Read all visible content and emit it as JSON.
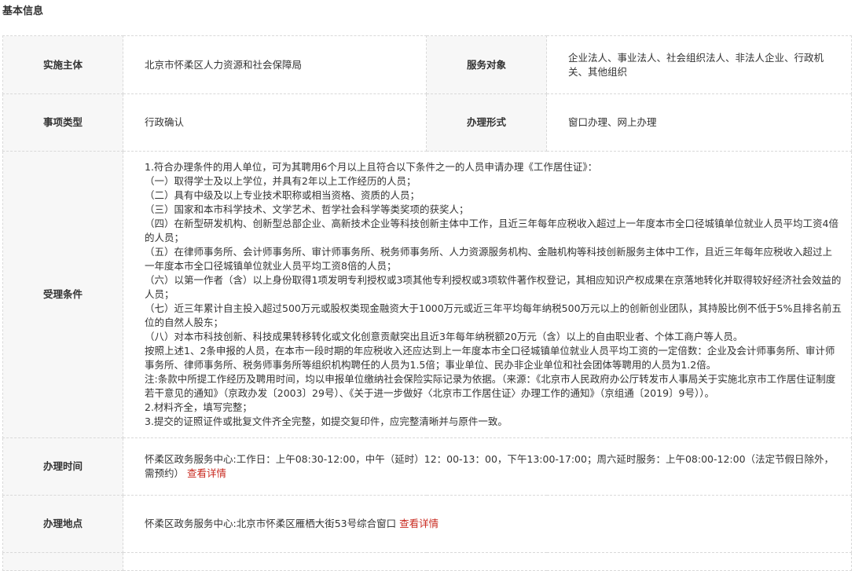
{
  "section": {
    "title": "基本信息"
  },
  "rows": {
    "implementer": {
      "label": "实施主体",
      "value": "北京市怀柔区人力资源和社会保障局"
    },
    "service_target": {
      "label": "服务对象",
      "value": "企业法人、事业法人、社会组织法人、非法人企业、行政机关、其他组织"
    },
    "item_type": {
      "label": "事项类型",
      "value": "行政确认"
    },
    "handling_form": {
      "label": "办理形式",
      "value": "窗口办理、网上办理"
    },
    "conditions": {
      "label": "受理条件",
      "lines": [
        "1.符合办理条件的用人单位，可为其聘用6个月以上且符合以下条件之一的人员申请办理《工作居住证》：",
        "（一）取得学士及以上学位，并具有2年以上工作经历的人员；",
        "（二）具有中级及以上专业技术职称或相当资格、资质的人员；",
        "（三）国家和本市科学技术、文学艺术、哲学社会科学等类奖项的获奖人；",
        "（四）在新型研发机构、创新型总部企业、高新技术企业等科技创新主体中工作，且近三年每年应税收入超过上一年度本市全口径城镇单位就业人员平均工资4倍的人员；",
        "（五）在律师事务所、会计师事务所、审计师事务所、税务师事务所、人力资源服务机构、金融机构等科技创新服务主体中工作，且近三年每年应税收入超过上一年度本市全口径城镇单位就业人员平均工资8倍的人员；",
        "（六）以第一作者（含）以上身份取得1项发明专利授权或3项其他专利授权或3项软件著作权登记，其相应知识产权成果在京落地转化并取得较好经济社会效益的人员；",
        "（七）近三年累计自主投入超过500万元或股权类现金融资大于1000万元或近三年平均每年纳税500万元以上的创新创业团队，其持股比例不低于5%且排名前五位的自然人股东；",
        "（八）对本市科技创新、科技成果转移转化或文化创意贡献突出且近3年每年纳税额20万元（含）以上的自由职业者、个体工商户等人员。",
        "按照上述1、2条申报的人员，在本市一段时期的年应税收入还应达到上一年度本市全口径城镇单位就业人员平均工资的一定倍数：企业及会计师事务所、审计师事务所、律师事务所、税务师事务所等组织机构聘任的人员为1.5倍；事业单位、民办非企业单位和社会团体等聘用的人员为1.2倍。",
        "注:条款中所提工作经历及聘用时间，均以申报单位缴纳社会保险实际记录为依据。（来源：《北京市人民政府办公厅转发市人事局关于实施北京市工作居住证制度若干意见的通知》（京政办发〔2003〕29号）、《关于进一步做好〈北京市工作居住证〉办理工作的通知》（京组通〔2019〕9号））。",
        "2.材料齐全，填写完整；",
        "3.提交的证照证件或批复文件齐全完整，如提交复印件，应完整清晰并与原件一致。"
      ]
    },
    "hours": {
      "label": "办理时间",
      "value": "怀柔区政务服务中心:工作日：上午08:30-12:00，中午（延时）12：00-13：00，下午13:00-17:00；周六延时服务：上午08:00-12:00（法定节假日除外，需预约）",
      "link": "查看详情"
    },
    "location": {
      "label": "办理地点",
      "value": "怀柔区政务服务中心:北京市怀柔区雁栖大街53号综合窗口",
      "link": "查看详情"
    }
  }
}
